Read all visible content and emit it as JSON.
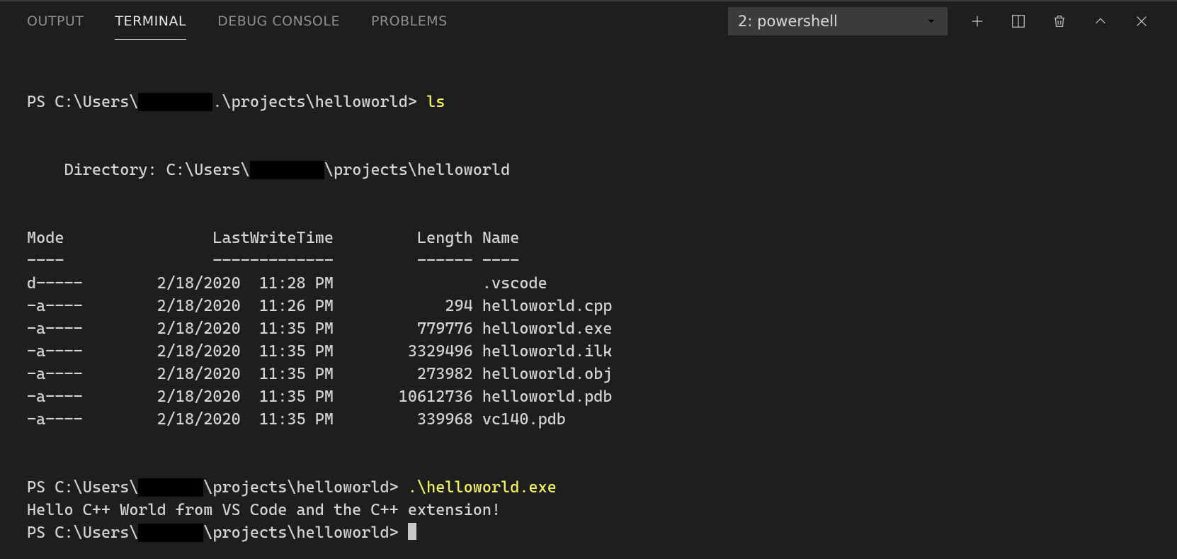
{
  "tabs": {
    "output": "OUTPUT",
    "terminal": "TERMINAL",
    "debug": "DEBUG CONSOLE",
    "problems": "PROBLEMS"
  },
  "shellSelect": {
    "label": "2: powershell"
  },
  "prompt": {
    "prefix": "PS C:\\Users\\",
    "redacted": "        ",
    "redacted2": "       ",
    "suffixDot": ".\\projects\\helloworld> ",
    "suffix": "\\projects\\helloworld> ",
    "suffixNoCmd": "\\projects\\helloworld>"
  },
  "cmd1": "ls",
  "cmd2": ".\\helloworld.exe",
  "dirLine": {
    "indent": "    Directory: C:\\Users\\",
    "after": "\\projects\\helloworld"
  },
  "header": {
    "mode": "Mode                LastWriteTime         Length Name",
    "rule": "----                -------------         ------ ----"
  },
  "rows": [
    {
      "line": "d-----        2/18/2020  11:28 PM                .vscode"
    },
    {
      "line": "-a----        2/18/2020  11:26 PM            294 helloworld.cpp"
    },
    {
      "line": "-a----        2/18/2020  11:35 PM         779776 helloworld.exe"
    },
    {
      "line": "-a----        2/18/2020  11:35 PM        3329496 helloworld.ilk"
    },
    {
      "line": "-a----        2/18/2020  11:35 PM         273982 helloworld.obj"
    },
    {
      "line": "-a----        2/18/2020  11:35 PM       10612736 helloworld.pdb"
    },
    {
      "line": "-a----        2/18/2020  11:35 PM         339968 vc140.pdb"
    }
  ],
  "outputLine": "Hello C++ World from VS Code and the C++ extension!"
}
